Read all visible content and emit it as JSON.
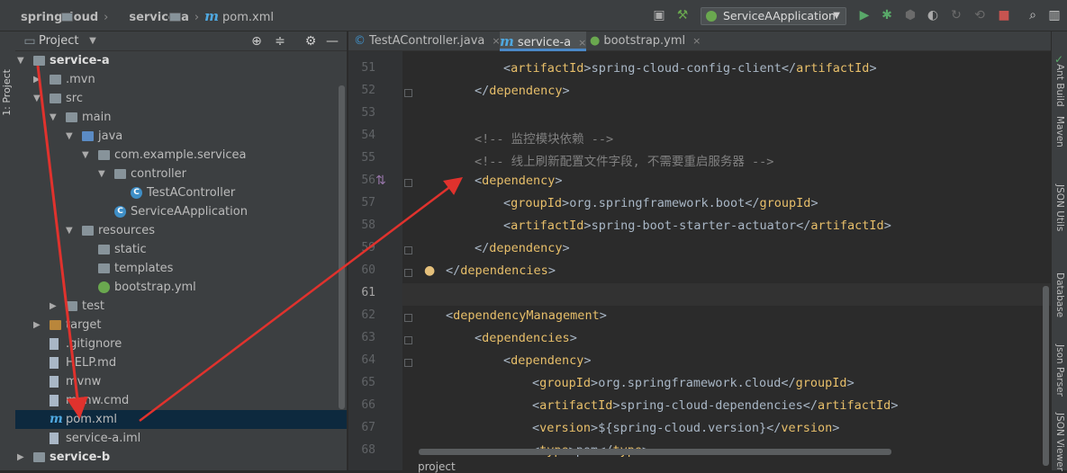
{
  "breadcrumb": [
    "springcloud",
    "service-a",
    "pom.xml"
  ],
  "run_config": "ServiceAApplication",
  "left_strip_label": "1: Project",
  "project_panel": {
    "title": "Project"
  },
  "tree": [
    {
      "label": "service-a",
      "depth": 0,
      "icon": "folder-module",
      "expand": "down",
      "bold": true
    },
    {
      "label": ".mvn",
      "depth": 1,
      "icon": "folder",
      "expand": "right"
    },
    {
      "label": "src",
      "depth": 1,
      "icon": "folder",
      "expand": "down"
    },
    {
      "label": "main",
      "depth": 2,
      "icon": "folder",
      "expand": "down"
    },
    {
      "label": "java",
      "depth": 3,
      "icon": "folder-blue",
      "expand": "down"
    },
    {
      "label": "com.example.servicea",
      "depth": 4,
      "icon": "folder",
      "expand": "down"
    },
    {
      "label": "controller",
      "depth": 5,
      "icon": "folder",
      "expand": "down"
    },
    {
      "label": "TestAController",
      "depth": 6,
      "icon": "class"
    },
    {
      "label": "ServiceAApplication",
      "depth": 5,
      "icon": "spring-class"
    },
    {
      "label": "resources",
      "depth": 3,
      "icon": "folder",
      "expand": "down"
    },
    {
      "label": "static",
      "depth": 4,
      "icon": "folder"
    },
    {
      "label": "templates",
      "depth": 4,
      "icon": "folder"
    },
    {
      "label": "bootstrap.yml",
      "depth": 4,
      "icon": "spring"
    },
    {
      "label": "test",
      "depth": 2,
      "icon": "folder",
      "expand": "right"
    },
    {
      "label": "target",
      "depth": 1,
      "icon": "folder-orange",
      "expand": "right"
    },
    {
      "label": ".gitignore",
      "depth": 1,
      "icon": "file"
    },
    {
      "label": "HELP.md",
      "depth": 1,
      "icon": "file"
    },
    {
      "label": "mvnw",
      "depth": 1,
      "icon": "file"
    },
    {
      "label": "mvnw.cmd",
      "depth": 1,
      "icon": "file"
    },
    {
      "label": "pom.xml",
      "depth": 1,
      "icon": "maven",
      "selected": true
    },
    {
      "label": "service-a.iml",
      "depth": 1,
      "icon": "file"
    },
    {
      "label": "service-b",
      "depth": 0,
      "icon": "folder-module",
      "expand": "right",
      "bold": true
    }
  ],
  "tabs": [
    {
      "label": "TestAController.java",
      "icon": "class"
    },
    {
      "label": "service-a",
      "icon": "maven",
      "active": true
    },
    {
      "label": "bootstrap.yml",
      "icon": "spring"
    }
  ],
  "code_lines": [
    {
      "n": "51",
      "indent": 2,
      "parts": [
        [
          "b",
          "<"
        ],
        [
          "t",
          "artifactId"
        ],
        [
          "b",
          ">"
        ],
        [
          "x",
          "spring-cloud-config-client"
        ],
        [
          "b",
          "</"
        ],
        [
          "t",
          "artifactId"
        ],
        [
          "b",
          ">"
        ]
      ]
    },
    {
      "n": "52",
      "indent": 1,
      "parts": [
        [
          "b",
          "</"
        ],
        [
          "t",
          "dependency"
        ],
        [
          "b",
          ">"
        ]
      ]
    },
    {
      "n": "53",
      "indent": 0,
      "parts": []
    },
    {
      "n": "54",
      "indent": 1,
      "parts": [
        [
          "c",
          "<!-- 监控模块依赖 -->"
        ]
      ]
    },
    {
      "n": "55",
      "indent": 1,
      "parts": [
        [
          "c",
          "<!-- 线上刷新配置文件字段, 不需要重启服务器 -->"
        ]
      ]
    },
    {
      "n": "56",
      "indent": 1,
      "parts": [
        [
          "b",
          "<"
        ],
        [
          "t",
          "dependency"
        ],
        [
          "b",
          ">"
        ]
      ]
    },
    {
      "n": "57",
      "indent": 2,
      "parts": [
        [
          "b",
          "<"
        ],
        [
          "t",
          "groupId"
        ],
        [
          "b",
          ">"
        ],
        [
          "x",
          "org.springframework.boot"
        ],
        [
          "b",
          "</"
        ],
        [
          "t",
          "groupId"
        ],
        [
          "b",
          ">"
        ]
      ]
    },
    {
      "n": "58",
      "indent": 2,
      "parts": [
        [
          "b",
          "<"
        ],
        [
          "t",
          "artifactId"
        ],
        [
          "b",
          ">"
        ],
        [
          "x",
          "spring-boot-starter-actuator"
        ],
        [
          "b",
          "</"
        ],
        [
          "t",
          "artifactId"
        ],
        [
          "b",
          ">"
        ]
      ]
    },
    {
      "n": "59",
      "indent": 1,
      "parts": [
        [
          "b",
          "</"
        ],
        [
          "t",
          "dependency"
        ],
        [
          "b",
          ">"
        ]
      ]
    },
    {
      "n": "60",
      "indent": 0,
      "parts": [
        [
          "b",
          "</"
        ],
        [
          "t",
          "dependencies"
        ],
        [
          "b",
          ">"
        ]
      ]
    },
    {
      "n": "61",
      "indent": 0,
      "parts": []
    },
    {
      "n": "62",
      "indent": 0,
      "parts": [
        [
          "b",
          "<"
        ],
        [
          "t",
          "dependencyManagement"
        ],
        [
          "b",
          ">"
        ]
      ]
    },
    {
      "n": "63",
      "indent": 1,
      "parts": [
        [
          "b",
          "<"
        ],
        [
          "t",
          "dependencies"
        ],
        [
          "b",
          ">"
        ]
      ]
    },
    {
      "n": "64",
      "indent": 2,
      "parts": [
        [
          "b",
          "<"
        ],
        [
          "t",
          "dependency"
        ],
        [
          "b",
          ">"
        ]
      ]
    },
    {
      "n": "65",
      "indent": 3,
      "parts": [
        [
          "b",
          "<"
        ],
        [
          "t",
          "groupId"
        ],
        [
          "b",
          ">"
        ],
        [
          "x",
          "org.springframework.cloud"
        ],
        [
          "b",
          "</"
        ],
        [
          "t",
          "groupId"
        ],
        [
          "b",
          ">"
        ]
      ]
    },
    {
      "n": "66",
      "indent": 3,
      "parts": [
        [
          "b",
          "<"
        ],
        [
          "t",
          "artifactId"
        ],
        [
          "b",
          ">"
        ],
        [
          "x",
          "spring-cloud-dependencies"
        ],
        [
          "b",
          "</"
        ],
        [
          "t",
          "artifactId"
        ],
        [
          "b",
          ">"
        ]
      ]
    },
    {
      "n": "67",
      "indent": 3,
      "parts": [
        [
          "b",
          "<"
        ],
        [
          "t",
          "version"
        ],
        [
          "b",
          ">"
        ],
        [
          "x",
          "${spring-cloud.version}"
        ],
        [
          "b",
          "</"
        ],
        [
          "t",
          "version"
        ],
        [
          "b",
          ">"
        ]
      ]
    },
    {
      "n": "68",
      "indent": 3,
      "parts": [
        [
          "b",
          "<"
        ],
        [
          "t",
          "type"
        ],
        [
          "b",
          ">"
        ],
        [
          "x",
          "pom"
        ],
        [
          "b",
          "</"
        ],
        [
          "t",
          "type"
        ],
        [
          "b",
          ">"
        ]
      ]
    }
  ],
  "current_line": "61",
  "right_tools": [
    "Ant Build",
    "Maven",
    "JSON Utils",
    "Database",
    "Json Parser",
    "JSON Viewer"
  ],
  "bottom_label": "project",
  "colors": {
    "tag": "#e8bf6a",
    "comment": "#808080",
    "text": "#a9b7c6",
    "annotation_arrow": "#e0322d"
  }
}
